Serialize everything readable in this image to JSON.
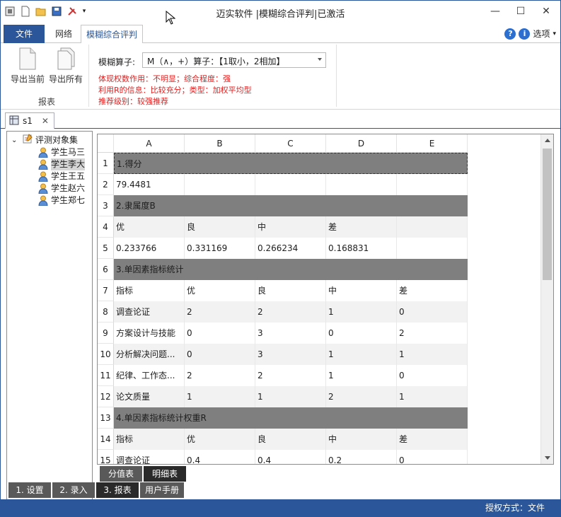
{
  "window": {
    "title": "迈实软件 |模糊综合评判|已激活"
  },
  "ribbon_tabs": [
    {
      "label": "文件"
    },
    {
      "label": "网络"
    },
    {
      "label": "模糊综合评判"
    }
  ],
  "options_label": "选项",
  "ribbon": {
    "export_current": "导出当前",
    "export_all": "导出所有",
    "group_label": "报表",
    "operator_label": "模糊算子:",
    "operator_value": "M（∧，+）算子：【1取小，2相加】",
    "info_lines": [
      "体现权数作用：不明显；综合程度：强",
      "利用R的信息：比较充分；类型：加权平均型",
      "推荐级别：较强推荐"
    ]
  },
  "doc_tab": {
    "label": "s1"
  },
  "tree": {
    "root": "评测对象集",
    "items": [
      "学生马三",
      "学生李大",
      "学生王五",
      "学生赵六",
      "学生郑七"
    ],
    "selected_index": 1
  },
  "grid": {
    "columns": [
      "A",
      "B",
      "C",
      "D",
      "E"
    ],
    "rows": [
      {
        "num": "1",
        "type": "sect",
        "cells": [
          "1.得分"
        ]
      },
      {
        "num": "2",
        "type": "normal",
        "cells": [
          "79.4481",
          "",
          "",
          "",
          ""
        ]
      },
      {
        "num": "3",
        "type": "sect",
        "cells": [
          "2.隶属度B"
        ]
      },
      {
        "num": "4",
        "type": "alt",
        "cells": [
          "优",
          "良",
          "中",
          "差",
          ""
        ]
      },
      {
        "num": "5",
        "type": "normal",
        "cells": [
          "0.233766",
          "0.331169",
          "0.266234",
          "0.168831",
          ""
        ]
      },
      {
        "num": "6",
        "type": "sect",
        "cells": [
          "3.单因素指标统计"
        ]
      },
      {
        "num": "7",
        "type": "normal",
        "cells": [
          "指标",
          "优",
          "良",
          "中",
          "差"
        ]
      },
      {
        "num": "8",
        "type": "alt",
        "cells": [
          "调查论证",
          "2",
          "2",
          "1",
          "0"
        ]
      },
      {
        "num": "9",
        "type": "normal",
        "cells": [
          "方案设计与技能",
          "0",
          "3",
          "0",
          "2"
        ]
      },
      {
        "num": "10",
        "type": "alt",
        "cells": [
          "分析解决问题...",
          "0",
          "3",
          "1",
          "1"
        ]
      },
      {
        "num": "11",
        "type": "normal",
        "cells": [
          "纪律、工作态...",
          "2",
          "2",
          "1",
          "0"
        ]
      },
      {
        "num": "12",
        "type": "alt",
        "cells": [
          "论文质量",
          "1",
          "1",
          "2",
          "1"
        ]
      },
      {
        "num": "13",
        "type": "sect",
        "cells": [
          "4.单因素指标统计权重R"
        ]
      },
      {
        "num": "14",
        "type": "alt",
        "cells": [
          "指标",
          "优",
          "良",
          "中",
          "差"
        ]
      },
      {
        "num": "15",
        "type": "normal",
        "cells": [
          "调查论证",
          "0.4",
          "0.4",
          "0.2",
          "0"
        ]
      }
    ]
  },
  "sheet_tabs": [
    "分值表",
    "明细表"
  ],
  "bottom_tabs": [
    "1. 设置",
    "2. 录入",
    "3. 报表",
    "用户手册"
  ],
  "bottom_active": 2,
  "status_text": "授权方式：文件"
}
